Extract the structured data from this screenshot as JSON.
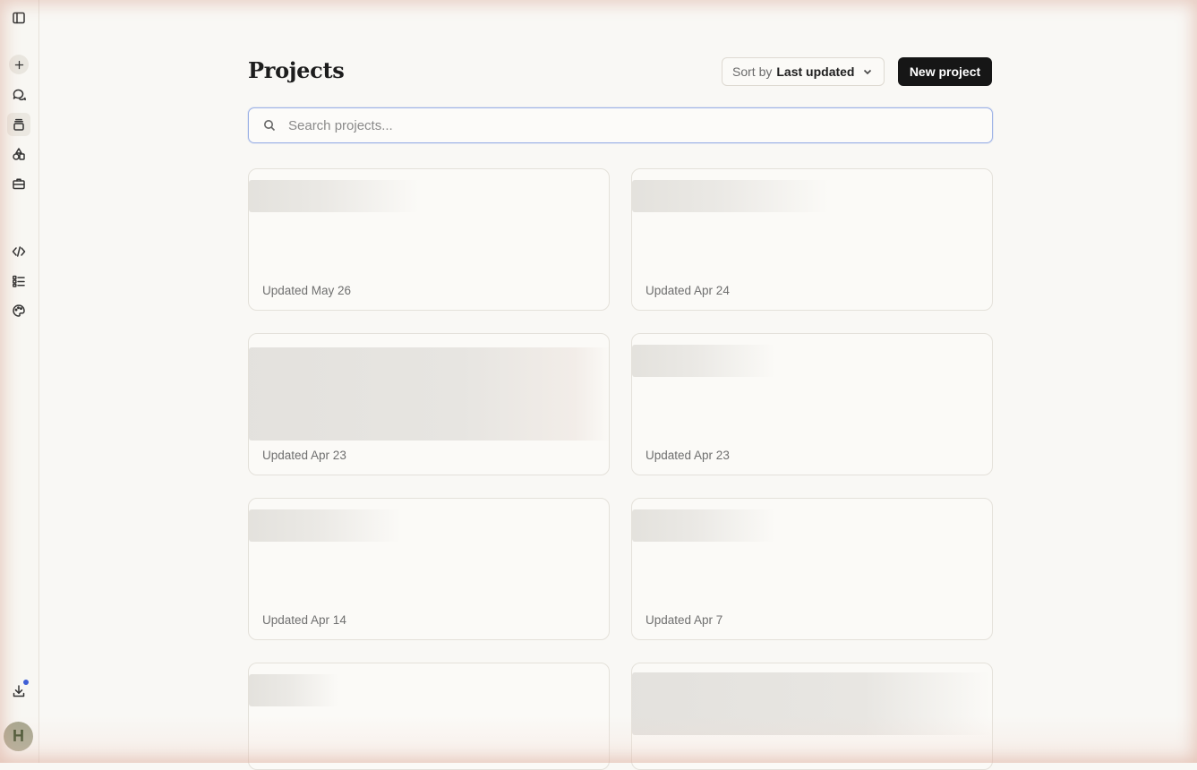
{
  "header": {
    "title": "Projects",
    "sort_prefix": "Sort by",
    "sort_value": "Last updated",
    "new_project_label": "New project"
  },
  "search": {
    "placeholder": "Search projects...",
    "value": ""
  },
  "sidebar": {
    "items": [
      {
        "icon": "sidebar-toggle-icon"
      },
      {
        "icon": "plus-icon"
      },
      {
        "icon": "chats-icon"
      },
      {
        "icon": "projects-icon",
        "active": true
      },
      {
        "icon": "artifacts-icon"
      },
      {
        "icon": "briefcase-icon"
      },
      {
        "icon": "code-icon"
      },
      {
        "icon": "checklist-icon"
      },
      {
        "icon": "palette-icon"
      },
      {
        "icon": "download-icon",
        "notification": true
      }
    ],
    "avatar_initial": "H"
  },
  "projects": [
    {
      "updated": "Updated May 26"
    },
    {
      "updated": "Updated Apr 24"
    },
    {
      "updated": "Updated Apr 23"
    },
    {
      "updated": "Updated Apr 23"
    },
    {
      "updated": "Updated Apr 14"
    },
    {
      "updated": "Updated Apr 7"
    },
    {
      "updated": ""
    },
    {
      "updated": ""
    }
  ],
  "colors": {
    "accent_button": "#161616",
    "search_focus_border": "#9db2e6",
    "notification_dot": "#3f5fd6"
  }
}
